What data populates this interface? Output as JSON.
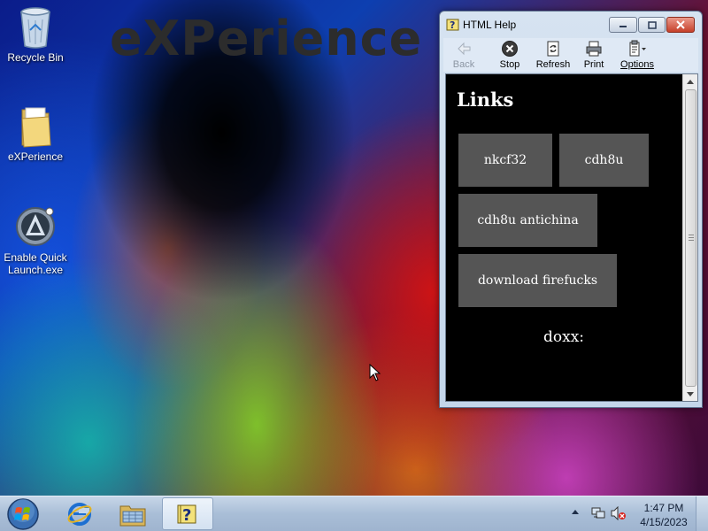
{
  "desktop": {
    "watermark": "eXPerience",
    "icons": [
      {
        "label": "Recycle Bin",
        "icon": "recycle-bin-icon"
      },
      {
        "label": "eXPerience",
        "icon": "folder-icon"
      },
      {
        "label": "Enable Quick Launch.exe",
        "icon": "quick-launch-icon"
      }
    ]
  },
  "window": {
    "title": "HTML Help",
    "toolbar": [
      {
        "label": "Back",
        "icon": "back-arrow-icon",
        "enabled": false
      },
      {
        "label": "Stop",
        "icon": "stop-icon",
        "enabled": true
      },
      {
        "label": "Refresh",
        "icon": "refresh-icon",
        "enabled": true
      },
      {
        "label": "Print",
        "icon": "print-icon",
        "enabled": true
      },
      {
        "label": "Options",
        "icon": "options-icon",
        "enabled": true
      }
    ],
    "content": {
      "heading": "Links",
      "links": [
        "nkcf32",
        "cdh8u",
        "cdh8u antichina",
        "download firefucks"
      ],
      "footer_text": "doxx:"
    }
  },
  "taskbar": {
    "apps": [
      "internet-explorer-icon",
      "windows-explorer-icon",
      "html-help-icon"
    ],
    "clock": {
      "time": "1:47 PM",
      "date": "4/15/2023"
    }
  },
  "colors": {
    "link_box": "#555555",
    "content_bg": "#000000",
    "taskbar": "#a9bed7"
  }
}
